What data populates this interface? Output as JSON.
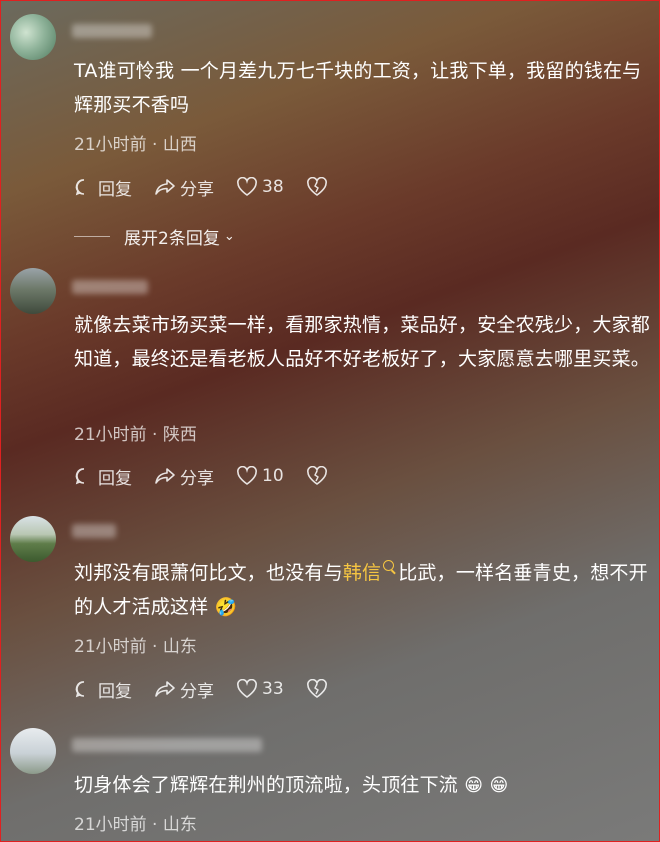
{
  "comments": [
    {
      "text": "TA谁可怜我 一个月差九万七千块的工资，让我下单，我留的钱在与辉那买不香吗",
      "time": "21小时前",
      "location": "山西",
      "reply_label": "回复",
      "share_label": "分享",
      "likes": "38",
      "expand_label": "展开2条回复"
    },
    {
      "text": "就像去菜市场买菜一样，看那家热情，菜品好，安全农残少，大家都知道，最终还是看老板人品好不好老板好了，大家愿意去哪里买菜。",
      "time": "21小时前",
      "location": "陕西",
      "reply_label": "回复",
      "share_label": "分享",
      "likes": "10"
    },
    {
      "text_before": "刘邦没有跟萧何比文，也没有与",
      "link": "韩信",
      "text_after": "比武，一样名垂青史，想不开的人才活成这样",
      "emoji": "🤣",
      "time": "21小时前",
      "location": "山东",
      "reply_label": "回复",
      "share_label": "分享",
      "likes": "33"
    },
    {
      "text": "切身体会了辉辉在荆州的顶流啦，头顶往下流",
      "emoji1": "😁",
      "emoji2": "😁",
      "time": "21小时前",
      "location": "山东"
    }
  ],
  "meta_separator": "·",
  "colors": {
    "link": "#f5c542",
    "frame": "#e02020"
  }
}
